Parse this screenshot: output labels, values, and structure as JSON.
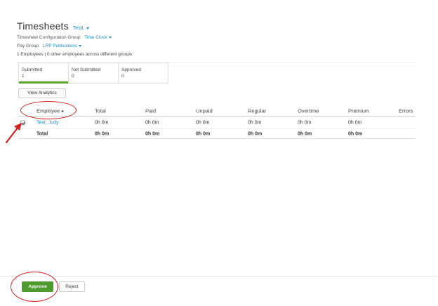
{
  "header": {
    "title": "Timesheets",
    "user_filter": "TestL"
  },
  "meta": {
    "config_group_label": "Timesheet Configuration Group",
    "config_group_value": "Time Clock",
    "pay_group_label": "Pay Group",
    "pay_group_value": "LRP Publications",
    "employee_count": "1 Employees",
    "other_employees": "0 other employees across different groups"
  },
  "status_tabs": [
    {
      "label": "Submitted",
      "count": "1",
      "active": true
    },
    {
      "label": "Not Submitted",
      "count": "0",
      "active": false
    },
    {
      "label": "Approved",
      "count": "0",
      "active": false
    }
  ],
  "toolbar": {
    "view_analytics_label": "View Analytics"
  },
  "table": {
    "columns": [
      "Employee",
      "Total",
      "Paid",
      "Unpaid",
      "Regular",
      "Overtime",
      "Premium",
      "Errors"
    ],
    "rows": [
      {
        "checked": true,
        "employee": "Test, Judy",
        "total": "0h 0m",
        "paid": "0h 0m",
        "unpaid": "0h 0m",
        "regular": "0h 0m",
        "overtime": "0h 0m",
        "premium": "0h 0m",
        "errors": ""
      }
    ],
    "totals": {
      "label": "Total",
      "total": "0h 0m",
      "paid": "0h 0m",
      "unpaid": "0h 0m",
      "regular": "0h 0m",
      "overtime": "0h 0m",
      "premium": "0h 0m"
    }
  },
  "footer": {
    "approve_label": "Approve",
    "reject_label": "Reject"
  },
  "colors": {
    "accent": "#1a8fd1",
    "approve": "#4e9a2e",
    "annotation": "#d21f1f"
  }
}
